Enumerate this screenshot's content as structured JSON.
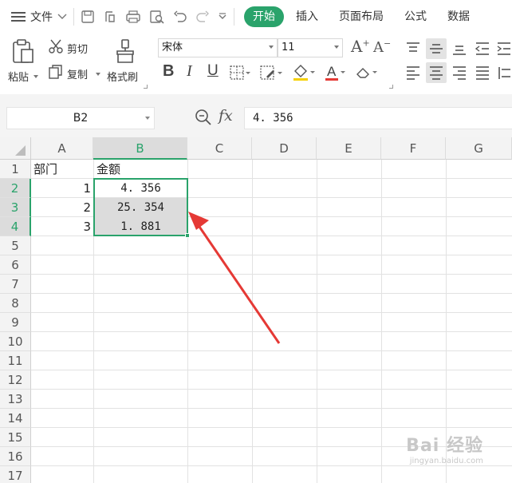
{
  "menubar": {
    "file_label": "文件",
    "tabs": [
      {
        "label": "开始",
        "active": true
      },
      {
        "label": "插入",
        "active": false
      },
      {
        "label": "页面布局",
        "active": false
      },
      {
        "label": "公式",
        "active": false
      },
      {
        "label": "数据",
        "active": false
      }
    ]
  },
  "ribbon": {
    "paste_label": "粘贴",
    "cut_label": "剪切",
    "copy_label": "复制",
    "format_painter_label": "格式刷",
    "font_name": "宋体",
    "font_size": "11"
  },
  "formula_bar": {
    "name_box": "B2",
    "fx_label": "fx",
    "formula_value": "4. 356"
  },
  "sheet": {
    "columns": [
      "A",
      "B",
      "C",
      "D",
      "E",
      "F",
      "G"
    ],
    "selected_column": "B",
    "rows": [
      "1",
      "2",
      "3",
      "4",
      "5",
      "6",
      "7",
      "8",
      "9",
      "10",
      "11",
      "12",
      "13",
      "14",
      "15",
      "16",
      "17"
    ],
    "selected_rows": [
      "2",
      "3",
      "4"
    ],
    "cells": {
      "A1": "部门",
      "B1": "金额",
      "A2": "1",
      "B2": "4. 356",
      "A3": "2",
      "B3": "25. 354",
      "A4": "3",
      "B4": "1. 881"
    }
  },
  "colors": {
    "accent": "#2aa36b",
    "annotation_arrow": "#e53935",
    "header_bg": "#f3f3f3",
    "selected_header_bg": "#dcdcdc"
  },
  "watermark": {
    "text": "Bai 经验",
    "sub": "jingyan.baidu.com"
  }
}
